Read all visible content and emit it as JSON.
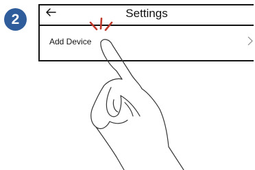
{
  "step": {
    "number": "2",
    "color": "#2f5c9a"
  },
  "screen": {
    "title": "Settings",
    "back_icon": "arrow-left-icon",
    "item": {
      "label": "Add Device",
      "chevron_icon": "chevron-right-icon"
    }
  },
  "illustration": {
    "hand_icon": "pointing-hand-icon",
    "tap_mark_color": "#c0392b"
  }
}
